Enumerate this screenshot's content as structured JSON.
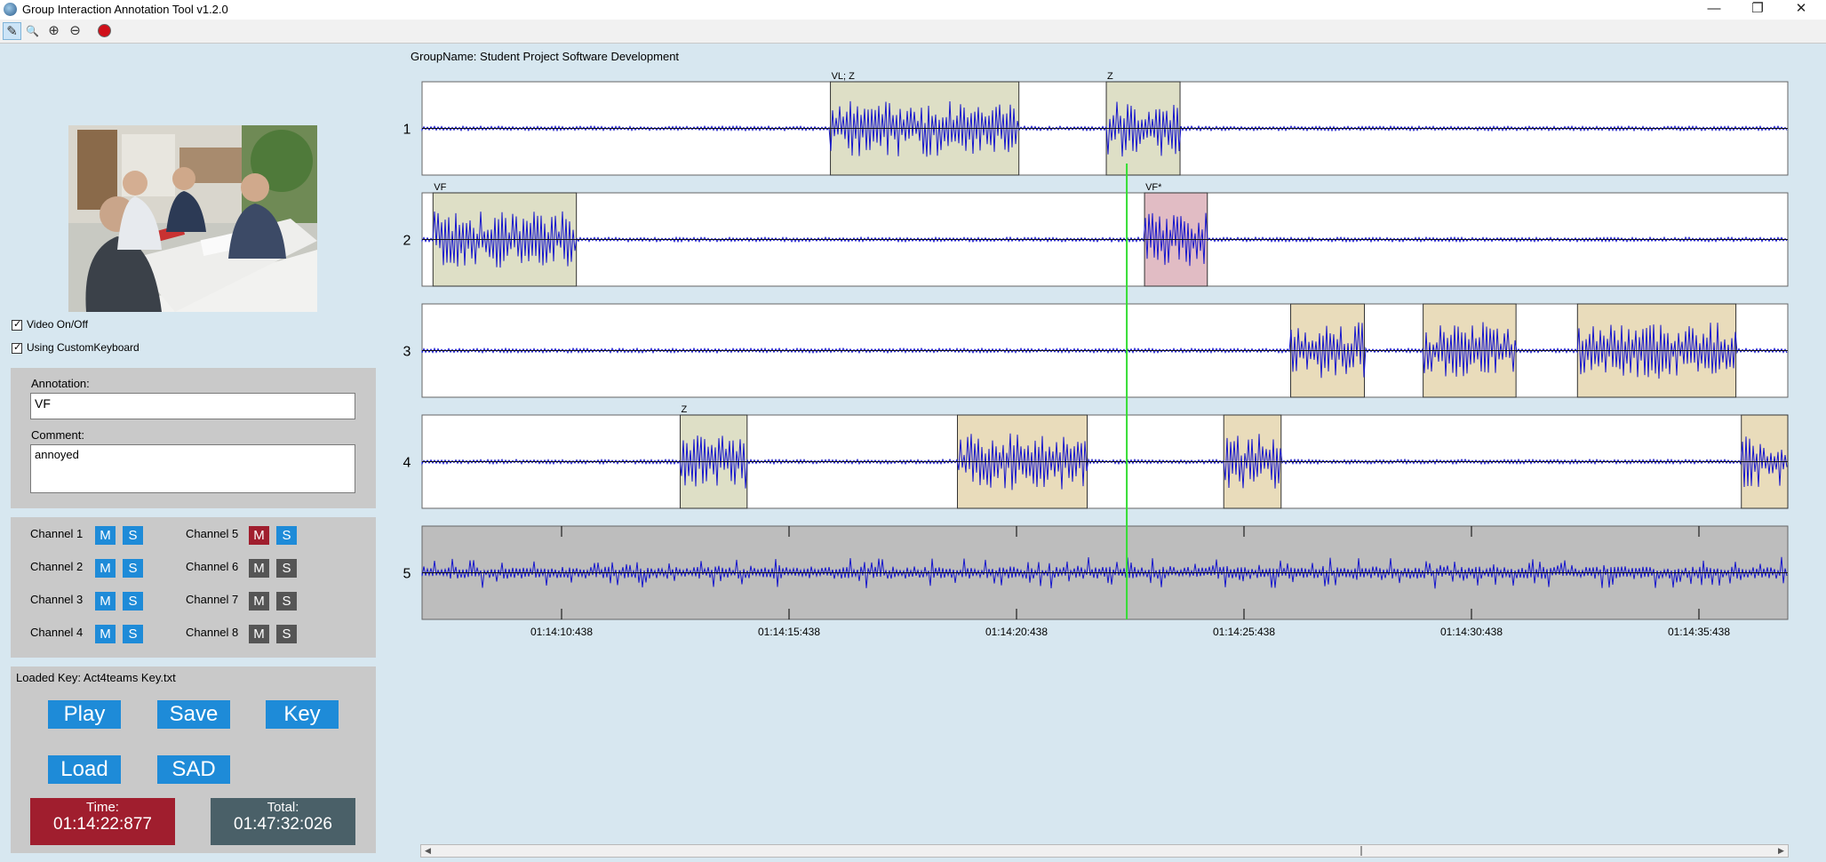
{
  "window": {
    "title": "Group Interaction Annotation Tool v1.2.0",
    "controls": {
      "minimize": "—",
      "restore": "❐",
      "close": "✕"
    }
  },
  "toolbar": {
    "tools": [
      {
        "name": "pencil-icon",
        "glyph": "✎"
      },
      {
        "name": "magnifier-icon",
        "glyph": "🔍"
      },
      {
        "name": "zoom-in-icon",
        "glyph": "⊕"
      },
      {
        "name": "zoom-out-icon",
        "glyph": "⊖"
      },
      {
        "name": "record-icon",
        "glyph": "●"
      }
    ]
  },
  "sidebar": {
    "video_toggle": {
      "label": "Video On/Off",
      "checked": true
    },
    "keyboard_toggle": {
      "label": "Using CustomKeyboard",
      "checked": true
    },
    "annotation": {
      "label": "Annotation:",
      "value": "VF"
    },
    "comment": {
      "label": "Comment:",
      "value": "annoyed"
    },
    "channels": [
      {
        "label": "Channel 1",
        "m": "M",
        "s": "S",
        "m_state": "blue",
        "s_state": "blue"
      },
      {
        "label": "Channel 2",
        "m": "M",
        "s": "S",
        "m_state": "blue",
        "s_state": "blue"
      },
      {
        "label": "Channel 3",
        "m": "M",
        "s": "S",
        "m_state": "blue",
        "s_state": "blue"
      },
      {
        "label": "Channel 4",
        "m": "M",
        "s": "S",
        "m_state": "blue",
        "s_state": "blue"
      },
      {
        "label": "Channel 5",
        "m": "M",
        "s": "S",
        "m_state": "red",
        "s_state": "blue"
      },
      {
        "label": "Channel 6",
        "m": "M",
        "s": "S",
        "m_state": "gray",
        "s_state": "gray"
      },
      {
        "label": "Channel 7",
        "m": "M",
        "s": "S",
        "m_state": "gray",
        "s_state": "gray"
      },
      {
        "label": "Channel 8",
        "m": "M",
        "s": "S",
        "m_state": "gray",
        "s_state": "gray"
      }
    ],
    "loaded_key": "Loaded Key: Act4teams Key.txt",
    "buttons": {
      "play": "Play",
      "save": "Save",
      "key": "Key",
      "load": "Load",
      "sad": "SAD"
    },
    "time": {
      "label": "Time:",
      "value": "01:14:22:877"
    },
    "total": {
      "label": "Total:",
      "value": "01:47:32:026"
    }
  },
  "timeline": {
    "group_name": "GroupName: Student Project Software Development",
    "tracks": [
      {
        "label": "1",
        "annotations": [
          {
            "label": "VL; Z",
            "start": 0.299,
            "end": 0.437,
            "color": "#dedfc6"
          },
          {
            "label": "Z",
            "start": 0.501,
            "end": 0.555,
            "color": "#dedfc6"
          }
        ]
      },
      {
        "label": "2",
        "annotations": [
          {
            "label": "VF",
            "start": 0.008,
            "end": 0.113,
            "color": "#dedfc6"
          },
          {
            "label": "VF*",
            "start": 0.529,
            "end": 0.575,
            "color": "#e1bcc4"
          }
        ]
      },
      {
        "label": "3",
        "annotations": [
          {
            "label": "",
            "start": 0.636,
            "end": 0.69,
            "color": "#e9dcbb"
          },
          {
            "label": "",
            "start": 0.733,
            "end": 0.801,
            "color": "#e9dcbb"
          },
          {
            "label": "",
            "start": 0.846,
            "end": 0.962,
            "color": "#e9dcbb"
          }
        ]
      },
      {
        "label": "4",
        "annotations": [
          {
            "label": "Z",
            "start": 0.189,
            "end": 0.238,
            "color": "#dedfc6"
          },
          {
            "label": "",
            "start": 0.392,
            "end": 0.487,
            "color": "#e9dcbb"
          },
          {
            "label": "",
            "start": 0.587,
            "end": 0.629,
            "color": "#e9dcbb"
          },
          {
            "label": "",
            "start": 0.966,
            "end": 1.0,
            "color": "#e9dcbb"
          }
        ]
      },
      {
        "label": "5",
        "annotations": []
      }
    ],
    "cursor_position": 0.516,
    "time_ticks": [
      "01:14:10:438",
      "01:14:15:438",
      "01:14:20:438",
      "01:14:25:438",
      "01:14:30:438",
      "01:14:35:438"
    ],
    "colors": {
      "waveform": "#1515cc",
      "cursor": "#33dd33",
      "mixed_track": "#bdbdbd"
    }
  }
}
